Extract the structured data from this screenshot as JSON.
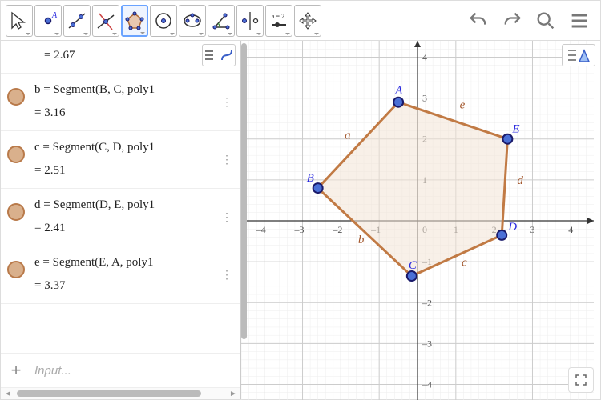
{
  "toolbar": {
    "tools": [
      {
        "name": "move-tool",
        "selected": false
      },
      {
        "name": "point-tool",
        "selected": false
      },
      {
        "name": "line-tool",
        "selected": false
      },
      {
        "name": "perpendicular-tool",
        "selected": false
      },
      {
        "name": "polygon-tool",
        "selected": true
      },
      {
        "name": "circle-tool",
        "selected": false
      },
      {
        "name": "ellipse-tool",
        "selected": false
      },
      {
        "name": "angle-tool",
        "selected": false
      },
      {
        "name": "reflect-tool",
        "selected": false
      },
      {
        "name": "slider-tool",
        "selected": false,
        "label": "a = 2"
      },
      {
        "name": "move-graphics-tool",
        "selected": false
      }
    ]
  },
  "algebra": {
    "first_value": "=  2.67",
    "items": [
      {
        "var": "b",
        "def": "b  =  Segment(B, C, poly1)",
        "val": "=  3.16"
      },
      {
        "var": "c",
        "def": "c  =  Segment(C, D, poly1)",
        "val": "=  2.51"
      },
      {
        "var": "d",
        "def": "d  =  Segment(D, E, poly1)",
        "val": "=  2.41"
      },
      {
        "var": "e",
        "def": "e  =  Segment(E, A, poly1)",
        "val": "=  3.37"
      }
    ],
    "input_placeholder": "Input..."
  },
  "graphics": {
    "xmin": -4.6,
    "xmax": 4.6,
    "ymin": -4.4,
    "ymax": 4.4,
    "xticks": [
      -4,
      -3,
      -2,
      -1,
      0,
      1,
      2,
      3,
      4
    ],
    "yticks": [
      -4,
      -3,
      -2,
      -1,
      1,
      2,
      3,
      4
    ],
    "points": {
      "A": {
        "x": -0.5,
        "y": 2.9,
        "label": "A"
      },
      "B": {
        "x": -2.6,
        "y": 0.8,
        "label": "B"
      },
      "C": {
        "x": -0.15,
        "y": -1.35,
        "label": "C"
      },
      "D": {
        "x": 2.2,
        "y": -0.35,
        "label": "D"
      },
      "E": {
        "x": 2.35,
        "y": 2.0,
        "label": "E"
      }
    },
    "edges": [
      {
        "name": "a",
        "from": "A",
        "to": "B",
        "lx": -1.9,
        "ly": 2.0
      },
      {
        "name": "b",
        "from": "B",
        "to": "C",
        "lx": -1.55,
        "ly": -0.55
      },
      {
        "name": "c",
        "from": "C",
        "to": "D",
        "lx": 1.15,
        "ly": -1.1
      },
      {
        "name": "d",
        "from": "D",
        "to": "E",
        "lx": 2.6,
        "ly": 0.9
      },
      {
        "name": "e",
        "from": "E",
        "to": "A",
        "lx": 1.1,
        "ly": 2.75
      }
    ],
    "fill": "#f3e3d6",
    "stroke": "#c17a44",
    "point_fill": "#4a6fd6",
    "point_stroke": "#1a1a6a",
    "label_color": "#2a2adf",
    "edge_label_color": "#a3572c"
  }
}
